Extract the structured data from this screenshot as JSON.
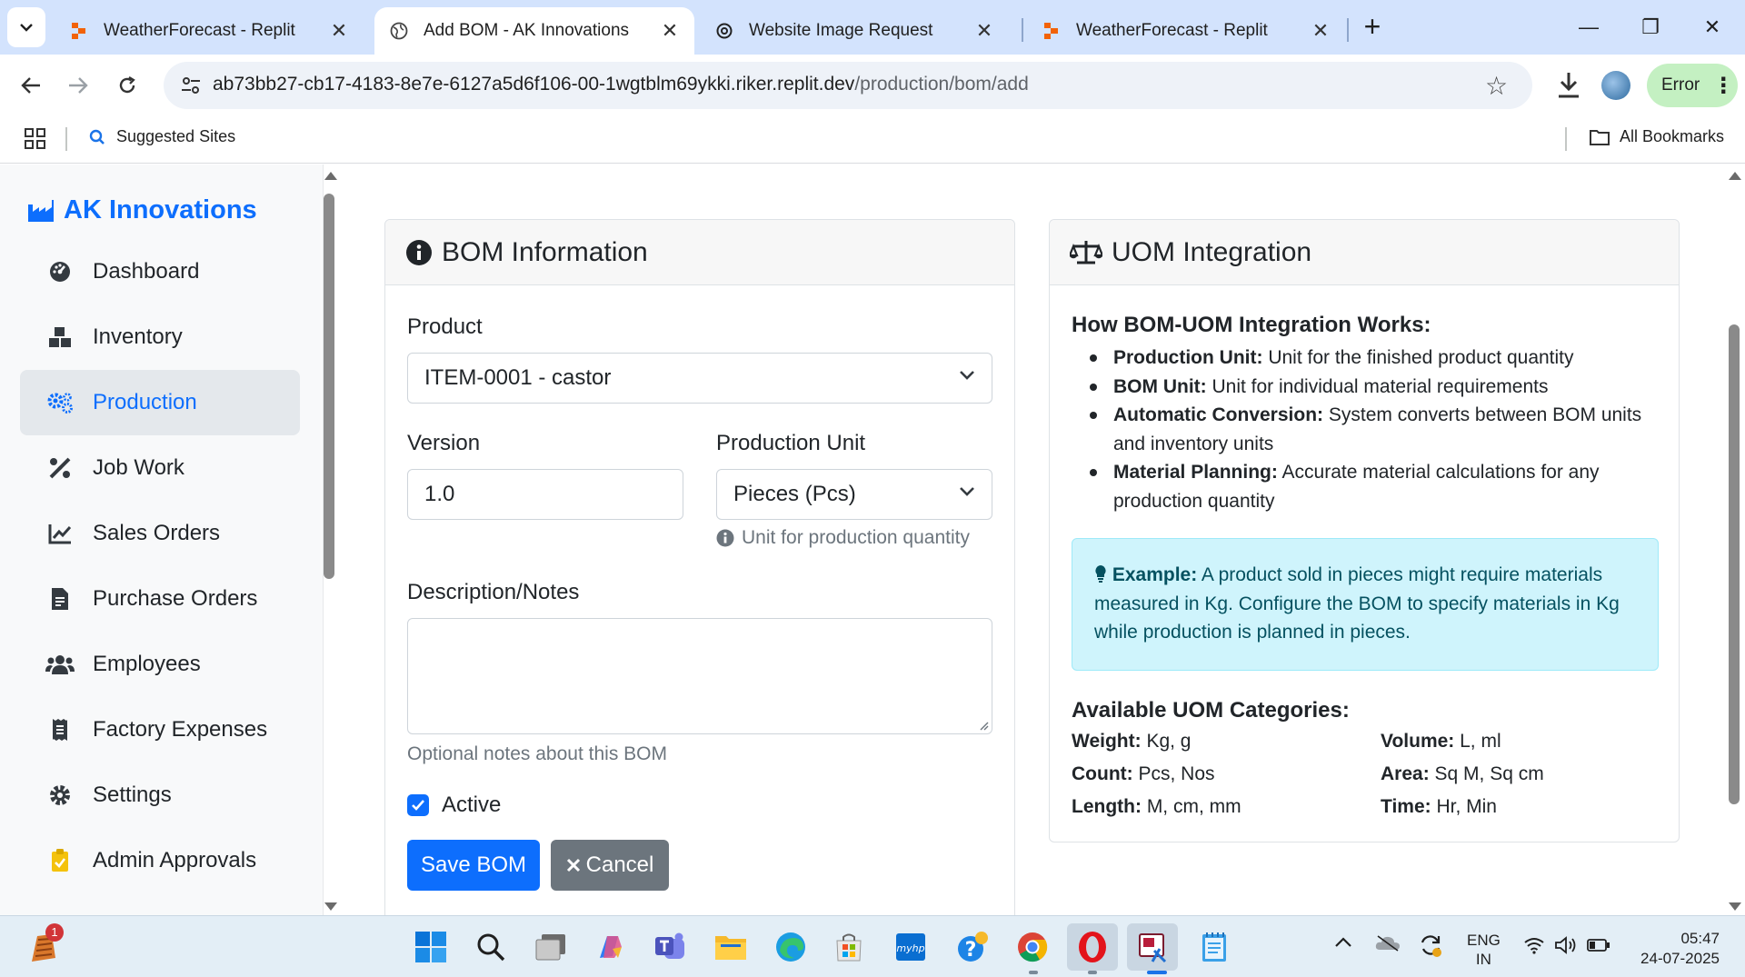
{
  "browser": {
    "tabs": [
      {
        "title": "WeatherForecast - Replit",
        "active": false
      },
      {
        "title": "Add BOM - AK Innovations",
        "active": true
      },
      {
        "title": "Website Image Request",
        "active": false
      },
      {
        "title": "WeatherForecast - Replit",
        "active": false
      }
    ],
    "url_host": "ab73bb27-cb17-4183-8e7e-6127a5d6f106-00-1wgtblm69ykki.riker.replit.dev",
    "url_path": "/production/bom/add",
    "error_label": "Error",
    "bookmarks": {
      "suggested": "Suggested Sites",
      "all": "All Bookmarks"
    }
  },
  "sidebar": {
    "brand": "AK Innovations",
    "items": [
      {
        "label": "Dashboard",
        "icon": "gauge-icon",
        "active": false
      },
      {
        "label": "Inventory",
        "icon": "boxes-icon",
        "active": false
      },
      {
        "label": "Production",
        "icon": "cogs-icon",
        "active": true
      },
      {
        "label": "Job Work",
        "icon": "tools-icon",
        "active": false
      },
      {
        "label": "Sales Orders",
        "icon": "line-chart-icon",
        "active": false
      },
      {
        "label": "Purchase Orders",
        "icon": "invoice-icon",
        "active": false
      },
      {
        "label": "Employees",
        "icon": "users-icon",
        "active": false
      },
      {
        "label": "Factory Expenses",
        "icon": "receipt-icon",
        "active": false
      },
      {
        "label": "Settings",
        "icon": "gear-icon",
        "active": false
      },
      {
        "label": "Admin Approvals",
        "icon": "clipboard-check-icon",
        "active": false
      }
    ]
  },
  "bom_form": {
    "title": "BOM Information",
    "product_label": "Product",
    "product_value": "ITEM-0001 - castor",
    "version_label": "Version",
    "version_value": "1.0",
    "unit_label": "Production Unit",
    "unit_value": "Pieces (Pcs)",
    "unit_hint": "Unit for production quantity",
    "desc_label": "Description/Notes",
    "desc_value": "",
    "desc_hint": "Optional notes about this BOM",
    "active_label": "Active",
    "active_checked": true,
    "save_label": "Save BOM",
    "cancel_label": "Cancel"
  },
  "uom_panel": {
    "title": "UOM Integration",
    "how_title": "How BOM-UOM Integration Works:",
    "points": [
      {
        "term": "Production Unit:",
        "text": " Unit for the finished product quantity"
      },
      {
        "term": "BOM Unit:",
        "text": " Unit for individual material requirements"
      },
      {
        "term": "Automatic Conversion:",
        "text": " System converts between BOM units and inventory units"
      },
      {
        "term": "Material Planning:",
        "text": " Accurate material calculations for any production quantity"
      }
    ],
    "example_term": "Example:",
    "example_text": " A product sold in pieces might require materials measured in Kg. Configure the BOM to specify materials in Kg while production is planned in pieces.",
    "categories_title": "Available UOM Categories:",
    "categories": [
      {
        "term": "Weight:",
        "text": " Kg, g"
      },
      {
        "term": "Volume:",
        "text": " L, ml"
      },
      {
        "term": "Count:",
        "text": " Pcs, Nos"
      },
      {
        "term": "Area:",
        "text": " Sq M, Sq cm"
      },
      {
        "term": "Length:",
        "text": " M, cm, mm"
      },
      {
        "term": "Time:",
        "text": " Hr, Min"
      }
    ]
  },
  "taskbar": {
    "notification_badge": "1",
    "lang_primary": "ENG",
    "lang_secondary": "IN",
    "time": "05:47",
    "date": "24-07-2025"
  },
  "colors": {
    "accent": "#0d6efd",
    "tabbar": "#d3e3fd",
    "alert_bg": "#cff4fc",
    "error_pill": "#c4f0c2"
  }
}
